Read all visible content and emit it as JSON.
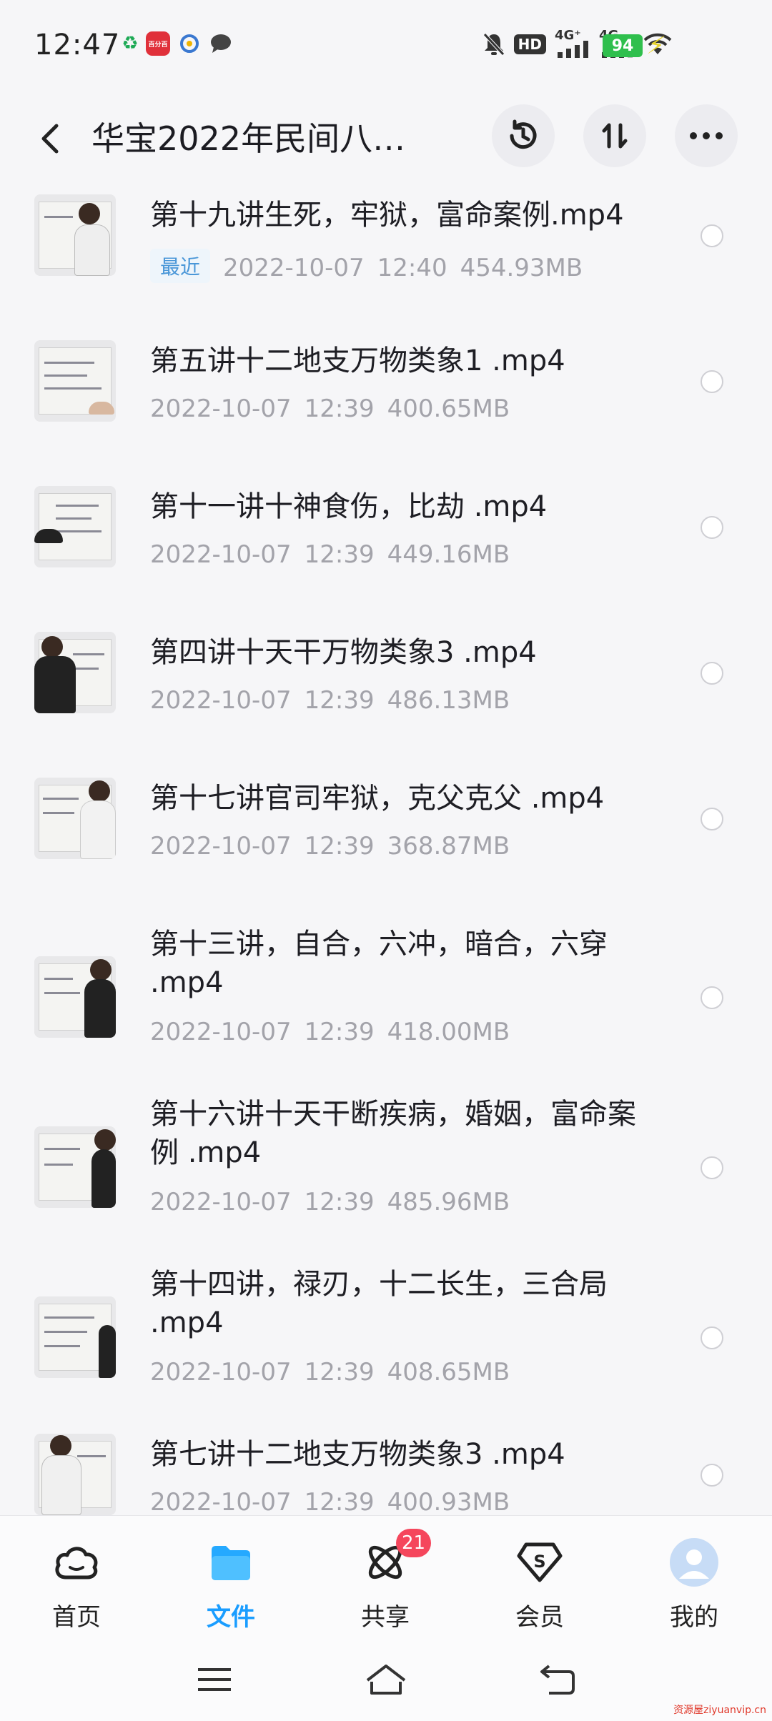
{
  "status_bar": {
    "time": "12:47",
    "notif_badge": "百分百",
    "network_a": "HD",
    "network_b": "4G⁺",
    "network_c": "4G",
    "battery": "94"
  },
  "header": {
    "title": "华宝2022年民间八…"
  },
  "files": [
    {
      "name": "第十九讲生死，牢狱，富命案例.mp4",
      "tag": "最近",
      "date": "2022-10-07",
      "time": "12:40",
      "size": "454.93MB"
    },
    {
      "name": "第五讲十二地支万物类象1 .mp4",
      "tag": "",
      "date": "2022-10-07",
      "time": "12:39",
      "size": "400.65MB"
    },
    {
      "name": "第十一讲十神食伤，比劫 .mp4",
      "tag": "",
      "date": "2022-10-07",
      "time": "12:39",
      "size": "449.16MB"
    },
    {
      "name": "第四讲十天干万物类象3 .mp4",
      "tag": "",
      "date": "2022-10-07",
      "time": "12:39",
      "size": "486.13MB"
    },
    {
      "name": "第十七讲官司牢狱，克父克父 .mp4",
      "tag": "",
      "date": "2022-10-07",
      "time": "12:39",
      "size": "368.87MB"
    },
    {
      "name": "第十三讲，自合，六冲，暗合，六穿 .mp4",
      "tag": "",
      "date": "2022-10-07",
      "time": "12:39",
      "size": "418.00MB"
    },
    {
      "name": "第十六讲十天干断疾病，婚姻，富命案例 .mp4",
      "tag": "",
      "date": "2022-10-07",
      "time": "12:39",
      "size": "485.96MB"
    },
    {
      "name": "第十四讲，禄刃，十二长生，三合局 .mp4",
      "tag": "",
      "date": "2022-10-07",
      "time": "12:39",
      "size": "408.65MB"
    },
    {
      "name": "第七讲十二地支万物类象3 .mp4",
      "tag": "",
      "date": "2022-10-07",
      "time": "12:39",
      "size": "400.93MB"
    }
  ],
  "bottom_nav": {
    "home": "首页",
    "files": "文件",
    "share": "共享",
    "share_badge": "21",
    "vip": "会员",
    "me": "我的",
    "active": "files"
  },
  "watermark": "资源屋ziyuanvip.cn",
  "colors": {
    "accent": "#1a9dff",
    "badge": "#f5465c",
    "battery": "#2fbf4d",
    "recent_tag": "#4a97d8"
  }
}
